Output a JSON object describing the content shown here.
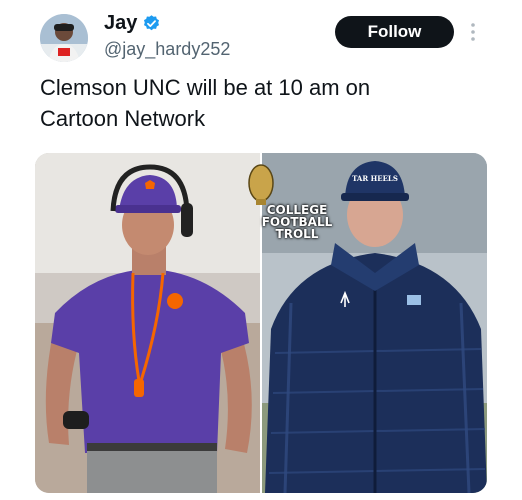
{
  "author": {
    "display_name": "Jay",
    "handle": "@jay_hardy252",
    "verified_icon": "verified-badge-icon",
    "avatar_icon": "avatar-photo"
  },
  "actions": {
    "follow_label": "Follow",
    "more_icon": "more-vertical-icon"
  },
  "tweet": {
    "text": "Clemson UNC will be at 10 am on\nCartoon Network"
  },
  "media": {
    "description_icon": "coaches-photo",
    "watermark": [
      "COLLEGE",
      "FOOTBALL",
      "TROLL"
    ],
    "cap_text": "TAR HEELS"
  },
  "colors": {
    "verified": "#1d9bf0",
    "follow_bg": "#0f1419",
    "clemson_purple": "#5a3fa8",
    "clemson_orange": "#f56600",
    "unc_navy": "#1c2f5a"
  }
}
